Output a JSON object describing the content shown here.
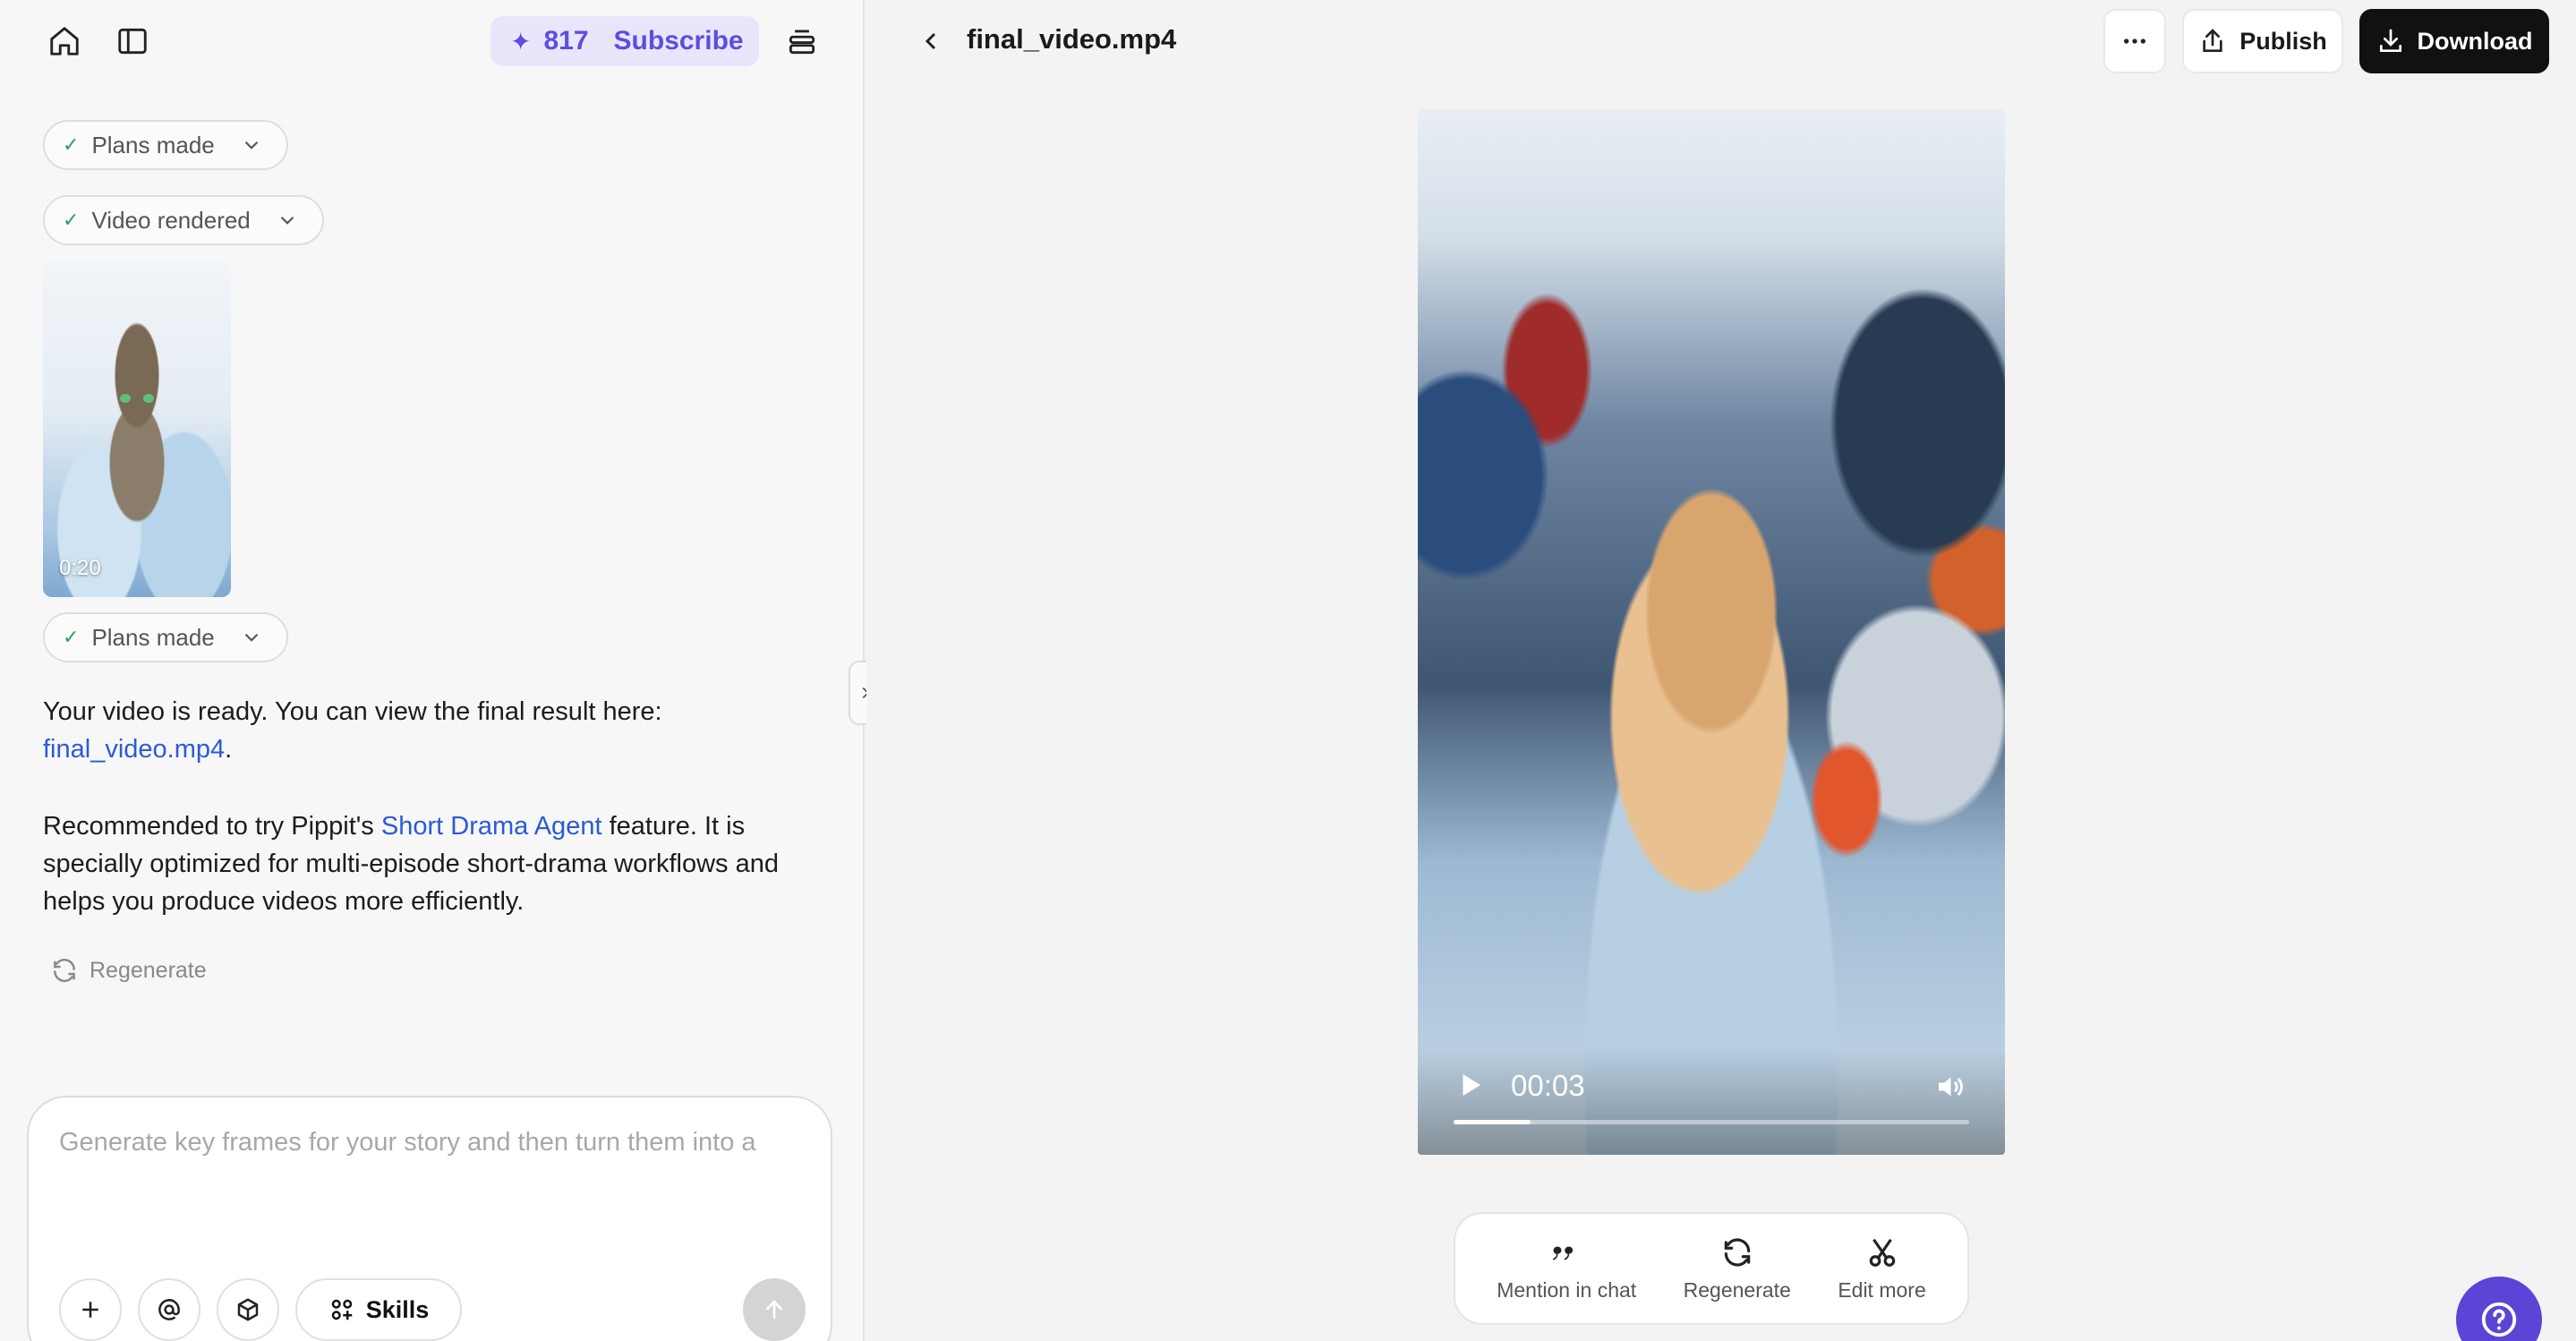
{
  "left_panel": {
    "credits": {
      "star": "✦",
      "count": "817",
      "subscribe": "Subscribe"
    },
    "pills": [
      {
        "label": "Plans made"
      },
      {
        "label": "Video rendered"
      },
      {
        "label": "Plans made"
      }
    ],
    "thumbnail": {
      "duration": "0:20"
    },
    "message": {
      "line1": "Your video is ready. You can view the final result here:",
      "file_link": "final_video.mp4",
      "period": ".",
      "rec_prefix": "Recommended to try Pippit's ",
      "rec_link": "Short Drama Agent",
      "rec_suffix": " feature. It is specially optimized for multi-episode short-drama workflows and helps you produce videos more efficiently."
    },
    "regenerate_label": "Regenerate",
    "composer": {
      "placeholder": "Generate key frames for your story and then turn them into a",
      "skills_label": "Skills"
    }
  },
  "right_panel": {
    "file_name": "final_video.mp4",
    "publish_label": "Publish",
    "download_label": "Download",
    "video": {
      "current_time": "00:03",
      "progress": 0.15
    },
    "actions": [
      {
        "label": "Mention in chat"
      },
      {
        "label": "Regenerate"
      },
      {
        "label": "Edit more"
      }
    ]
  },
  "colors": {
    "accent": "#5b4ee0",
    "link": "#2a5bd7",
    "success": "#2e9e5b",
    "download_bg": "#111111",
    "help_bg": "#5b45d6"
  }
}
